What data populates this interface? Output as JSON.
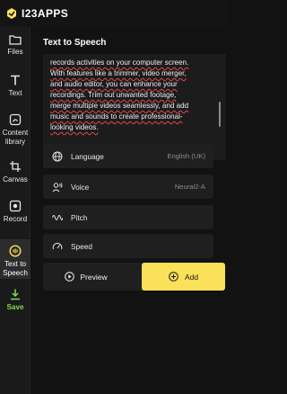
{
  "app": {
    "logo_text": "I23APPS"
  },
  "sidebar": {
    "items": [
      {
        "label": "Files",
        "icon": "folder-icon"
      },
      {
        "label": "Text",
        "icon": "text-t-icon"
      },
      {
        "label": "Content library",
        "icon": "content-library-icon"
      },
      {
        "label": "Canvas",
        "icon": "canvas-crop-icon"
      },
      {
        "label": "Record",
        "icon": "record-icon"
      },
      {
        "label": "Text to Speech",
        "icon": "speech-icon"
      },
      {
        "label": "Save",
        "icon": "download-icon"
      }
    ],
    "active_index": 5,
    "save_color": "#7ed957"
  },
  "panel": {
    "title": "Text to Speech",
    "text_lines": [
      "records activities on your computer screen.",
      "With features like a trimmer, video merger,",
      "and audio editor, you can enhance your",
      "recordings. Trim out unwanted footage,",
      "merge multiple videos seamlessly, and add",
      "music and sounds to create professional-",
      "looking videos."
    ]
  },
  "settings": {
    "language": {
      "label": "Language",
      "value": "English (UK)",
      "icon": "globe-icon"
    },
    "voice": {
      "label": "Voice",
      "value": "Neural2-A",
      "icon": "voice-icon"
    },
    "pitch": {
      "label": "Pitch",
      "icon": "pitch-wave-icon"
    },
    "speed": {
      "label": "Speed",
      "icon": "speedometer-icon"
    }
  },
  "actions": {
    "preview_label": "Preview",
    "add_label": "Add",
    "add_color": "#fbe15a"
  }
}
